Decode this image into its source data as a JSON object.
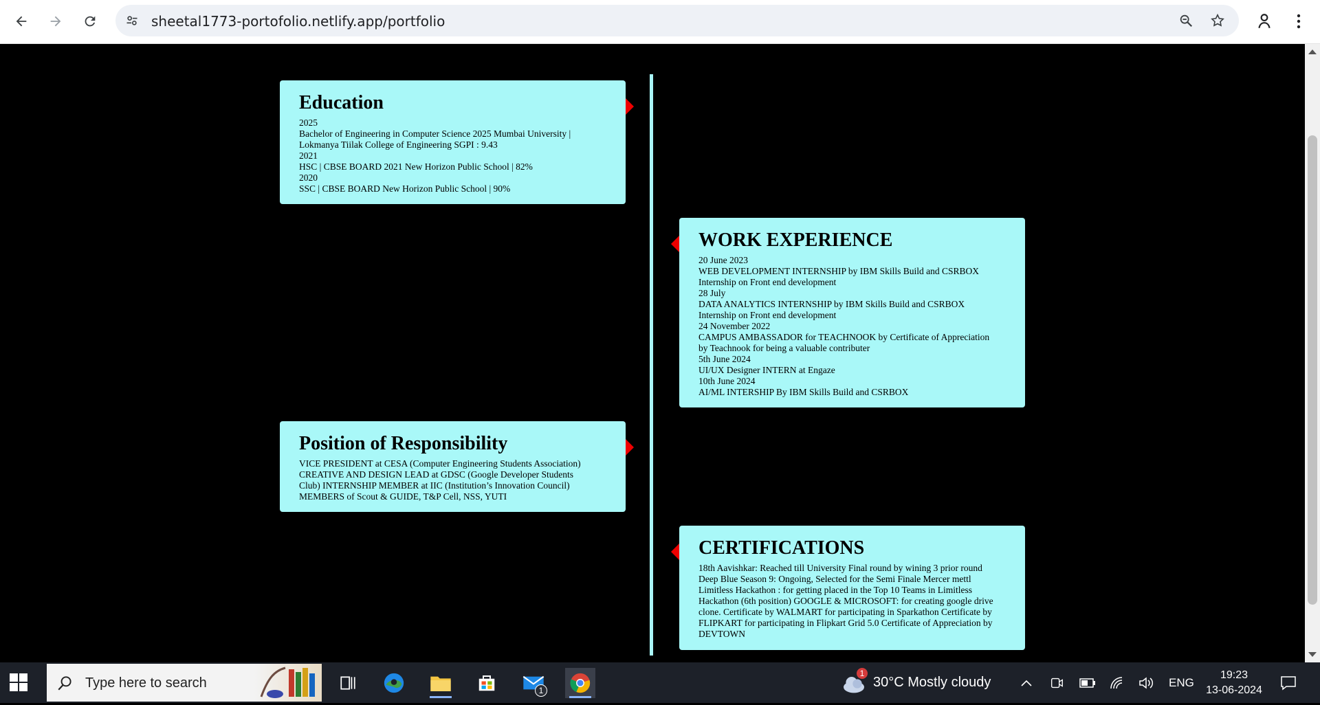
{
  "browser": {
    "url": "sheetal1773-portofolio.netlify.app/portfolio"
  },
  "education": {
    "title": "Education",
    "lines": [
      "2025",
      "Bachelor of Engineering in Computer Science 2025 Mumbai University |",
      "Lokmanya Tiilak College of Engineering SGPI : 9.43",
      "2021",
      "HSC | CBSE BOARD 2021 New Horizon Public School | 82%",
      "2020",
      "SSC | CBSE BOARD New Horizon Public School | 90%"
    ]
  },
  "work": {
    "title": "WORK EXPERIENCE",
    "lines": [
      "20 June 2023",
      "WEB DEVELOPMENT INTERNSHIP by IBM Skills Build and CSRBOX",
      "Internship on Front end development",
      "28 July",
      "DATA ANALYTICS INTERNSHIP by IBM Skills Build and CSRBOX",
      "Internship on Front end development",
      "24 November 2022",
      "CAMPUS AMBASSADOR for TEACHNOOK by Certificate of Appreciation",
      "by Teachnook for being a valuable contributer",
      "5th June 2024",
      "UI/UX Designer INTERN at Engaze",
      "10th June 2024",
      "AI/ML INTERSHIP By IBM Skills Build and CSRBOX"
    ]
  },
  "responsibility": {
    "title": "Position of Responsibility",
    "lines": [
      "VICE PRESIDENT at CESA (Computer Engineering Students Association)",
      "CREATIVE AND DESIGN LEAD at GDSC (Google Developer Students",
      "Club) INTERNSHIP MEMBER at IIC (Institution’s Innovation Council)",
      "MEMBERS of Scout & GUIDE, T&P Cell, NSS, YUTI"
    ]
  },
  "certifications": {
    "title": "CERTIFICATIONS",
    "lines": [
      "18th Aavishkar: Reached till University Final round by wining 3 prior round",
      "Deep Blue Season 9: Ongoing, Selected for the Semi Finale Mercer mettl",
      "Limitless Hackathon : for getting placed in the Top 10 Teams in Limitless",
      "Hackathon (6th position) GOOGLE & MICROSOFT: for creating google drive",
      "clone. Certificate by WALMART for participating in Sparkathon Certificate by",
      "FLIPKART for participating in Flipkart Grid 5.0 Certificate of Appreciation by",
      "DEVTOWN"
    ]
  },
  "colors": {
    "card_bg": "#a9f8f8",
    "arrow": "#ee0000",
    "timeline": "#a9f6f8",
    "page_bg": "#000000"
  },
  "taskbar": {
    "search_placeholder": "Type here to search",
    "mail_badge": "1",
    "weather_badge": "1",
    "weather": "30°C  Mostly cloudy",
    "language": "ENG",
    "time": "19:23",
    "date": "13-06-2024"
  }
}
